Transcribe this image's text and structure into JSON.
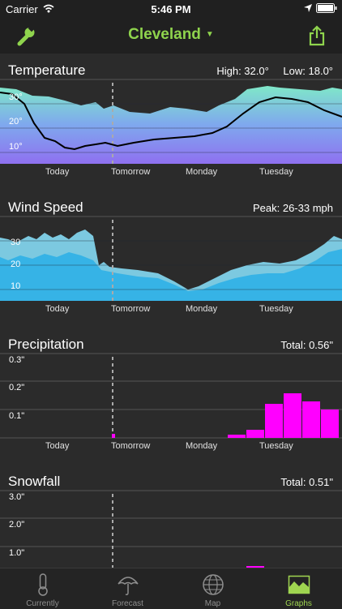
{
  "status": {
    "carrier": "Carrier",
    "time": "5:46 PM"
  },
  "header": {
    "city": "Cleveland"
  },
  "days": [
    "Today",
    "Tomorrow",
    "Monday",
    "Tuesday"
  ],
  "temperature": {
    "title": "Temperature",
    "high_label": "High: 32.0°",
    "low_label": "Low: 18.0°",
    "ticks": [
      "30°",
      "20°",
      "10°"
    ]
  },
  "wind": {
    "title": "Wind Speed",
    "peak_label": "Peak: 26-33 mph",
    "ticks": [
      "30",
      "20",
      "10"
    ]
  },
  "precipitation": {
    "title": "Precipitation",
    "total_label": "Total: 0.56\"",
    "ticks": [
      "0.3\"",
      "0.2\"",
      "0.1\""
    ]
  },
  "snowfall": {
    "title": "Snowfall",
    "total_label": "Total: 0.51\"",
    "ticks": [
      "3.0\"",
      "2.0\"",
      "1.0\""
    ]
  },
  "tabs": [
    {
      "label": "Currently",
      "icon": "thermometer-icon",
      "active": false
    },
    {
      "label": "Forecast",
      "icon": "umbrella-icon",
      "active": false
    },
    {
      "label": "Map",
      "icon": "globe-icon",
      "active": false
    },
    {
      "label": "Graphs",
      "icon": "graph-icon",
      "active": true
    }
  ],
  "colors": {
    "accent": "#8fd44d",
    "temp_top": "#7fe8c8",
    "temp_bottom": "#8f7cf0",
    "wind": "#35b7e8",
    "precip": "#ff00ff"
  }
}
